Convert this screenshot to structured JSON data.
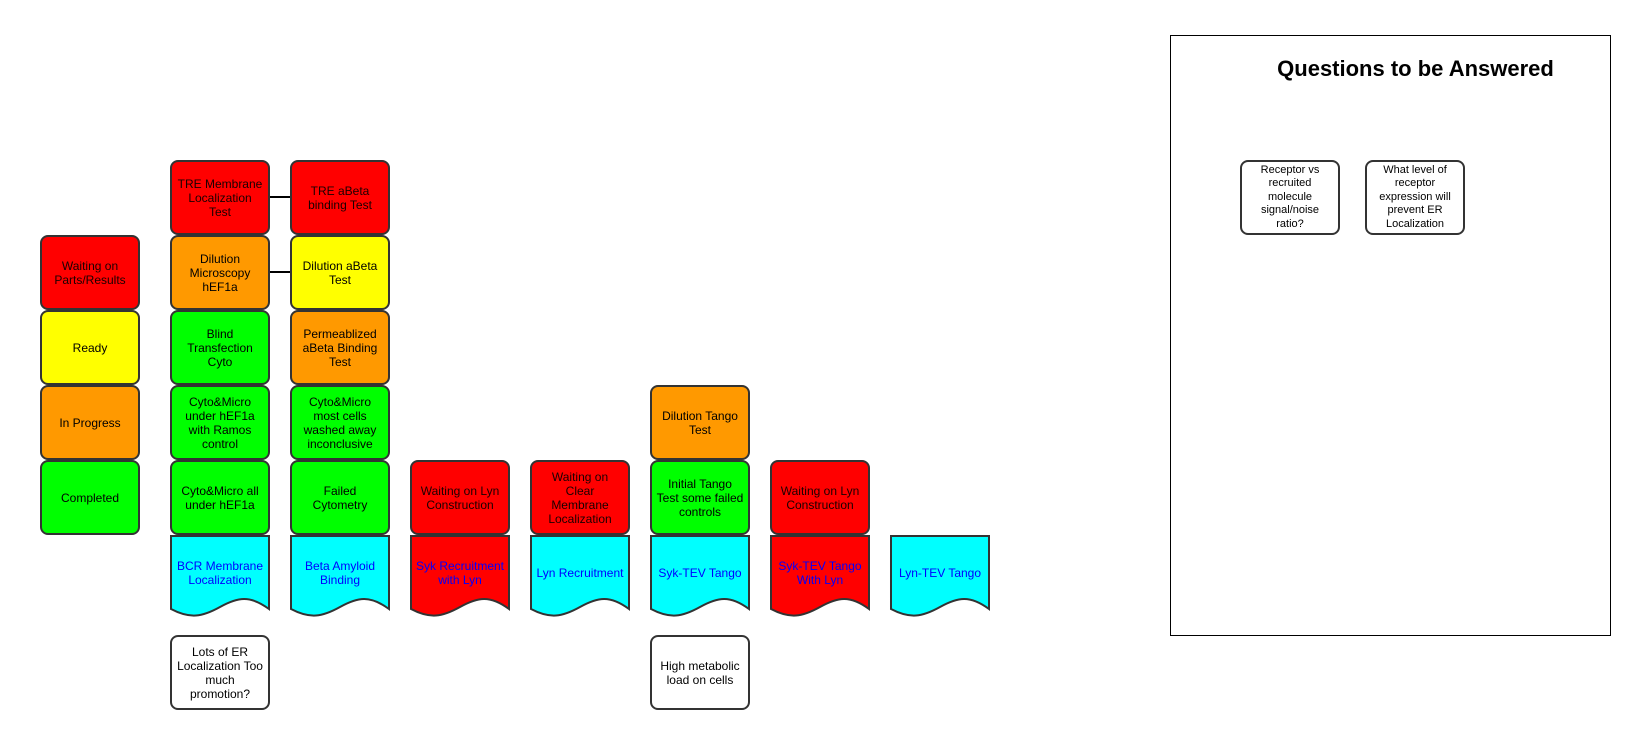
{
  "legend": {
    "items": [
      {
        "label": "Waiting on Parts/Results",
        "status": "waiting",
        "color": "#ff0000"
      },
      {
        "label": "Ready",
        "status": "ready",
        "color": "#ffff00"
      },
      {
        "label": "In Progress",
        "status": "in-progress",
        "color": "#ff9900"
      },
      {
        "label": "Completed",
        "status": "completed",
        "color": "#00ff00"
      }
    ]
  },
  "status_colors": {
    "waiting": "#ff0000",
    "ready": "#ffff00",
    "in_progress": "#ff9900",
    "completed": "#00ff00",
    "project": "#00ffff",
    "note": "#ffffff",
    "project_text": "#0000ff"
  },
  "projects": [
    {
      "name": "BCR Membrane Localization",
      "status": "project",
      "tasks": [
        {
          "label": "TRE Membrane Localization Test",
          "status": "waiting"
        },
        {
          "label": "Dilution Microscopy hEF1a",
          "status": "in-progress"
        },
        {
          "label": "Blind Transfection Cyto",
          "status": "completed"
        },
        {
          "label": "Cyto&Micro under hEF1a with Ramos control",
          "status": "completed"
        },
        {
          "label": "Cyto&Micro all under hEF1a",
          "status": "completed"
        }
      ],
      "note": "Lots of ER Localization Too much promotion?"
    },
    {
      "name": "Beta Amyloid Binding",
      "status": "project",
      "tasks": [
        {
          "label": "TRE aBeta binding Test",
          "status": "waiting"
        },
        {
          "label": "Dilution aBeta Test",
          "status": "ready"
        },
        {
          "label": "Permeablized aBeta Binding Test",
          "status": "in-progress"
        },
        {
          "label": "Cyto&Micro most cells washed away inconclusive",
          "status": "completed"
        },
        {
          "label": "Failed Cytometry",
          "status": "completed"
        }
      ]
    },
    {
      "name": "Syk Recruitment with Lyn",
      "status": "waiting",
      "tasks": [
        {
          "label": "Waiting on Lyn Construction",
          "status": "waiting"
        }
      ]
    },
    {
      "name": "Lyn Recruitment",
      "status": "project",
      "tasks": [
        {
          "label": "Waiting on Clear Membrane Localization",
          "status": "waiting"
        }
      ]
    },
    {
      "name": "Syk-TEV Tango",
      "status": "project",
      "tasks": [
        {
          "label": "Dilution Tango Test",
          "status": "in-progress"
        },
        {
          "label": "Initial Tango Test  some failed controls",
          "status": "completed"
        }
      ],
      "note": "High metabolic load on cells"
    },
    {
      "name": "Syk-TEV Tango With Lyn",
      "status": "waiting",
      "tasks": [
        {
          "label": "Waiting on Lyn Construction",
          "status": "waiting"
        }
      ]
    },
    {
      "name": "Lyn-TEV Tango",
      "status": "project",
      "tasks": []
    }
  ],
  "questions_panel": {
    "title": "Questions to be Answered",
    "questions": [
      "Receptor vs recruited molecule signal/noise ratio?",
      "What level of receptor expression will prevent ER Localization"
    ]
  }
}
